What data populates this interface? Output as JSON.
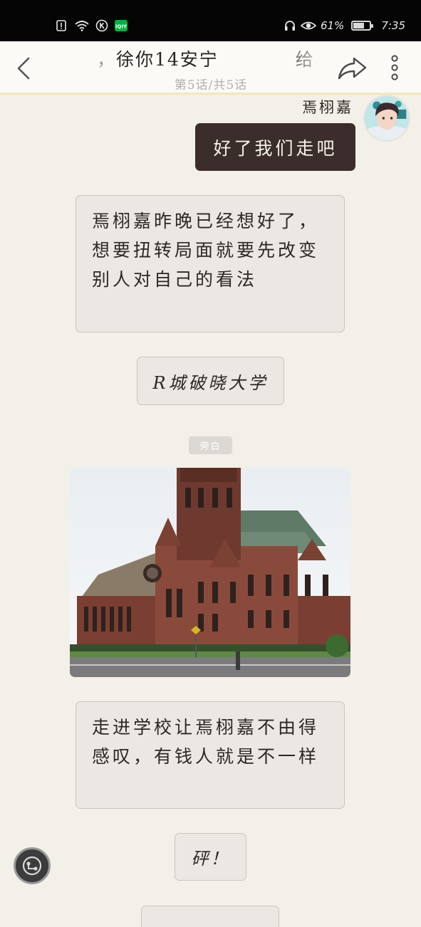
{
  "status_bar": {
    "battery_percent": "61%",
    "battery_level": 0.61,
    "time": "7:35",
    "icons": [
      "alert-icon",
      "wifi-icon",
      "k-app-icon",
      "iqiyi-app-icon",
      "headphones-icon",
      "eye-icon",
      "battery-icon"
    ]
  },
  "header": {
    "title": "，徐你14安宁　　　　给",
    "subtitle": "第5话/共5话",
    "icons": [
      "back-arrow-icon",
      "share-arrow-icon",
      "more-vertical-icon"
    ]
  },
  "chat": {
    "speaker_name": "焉栩嘉",
    "dialog": "好了我们走吧",
    "narration_1": "焉栩嘉昨晚已经想好了，想要扭转局面就要先改变别人对自己的看法",
    "location": "R城破晓大学",
    "aside_tag": "旁白",
    "narration_2": "走进学校让焉栩嘉不由得感叹，有钱人就是不一样",
    "sound": "砰！"
  },
  "colors": {
    "background": "#f3f0ea",
    "dialog_bubble": "#3b2d2b",
    "narration_box": "#ebe8e3",
    "header_accent": "#f4e7b9"
  }
}
